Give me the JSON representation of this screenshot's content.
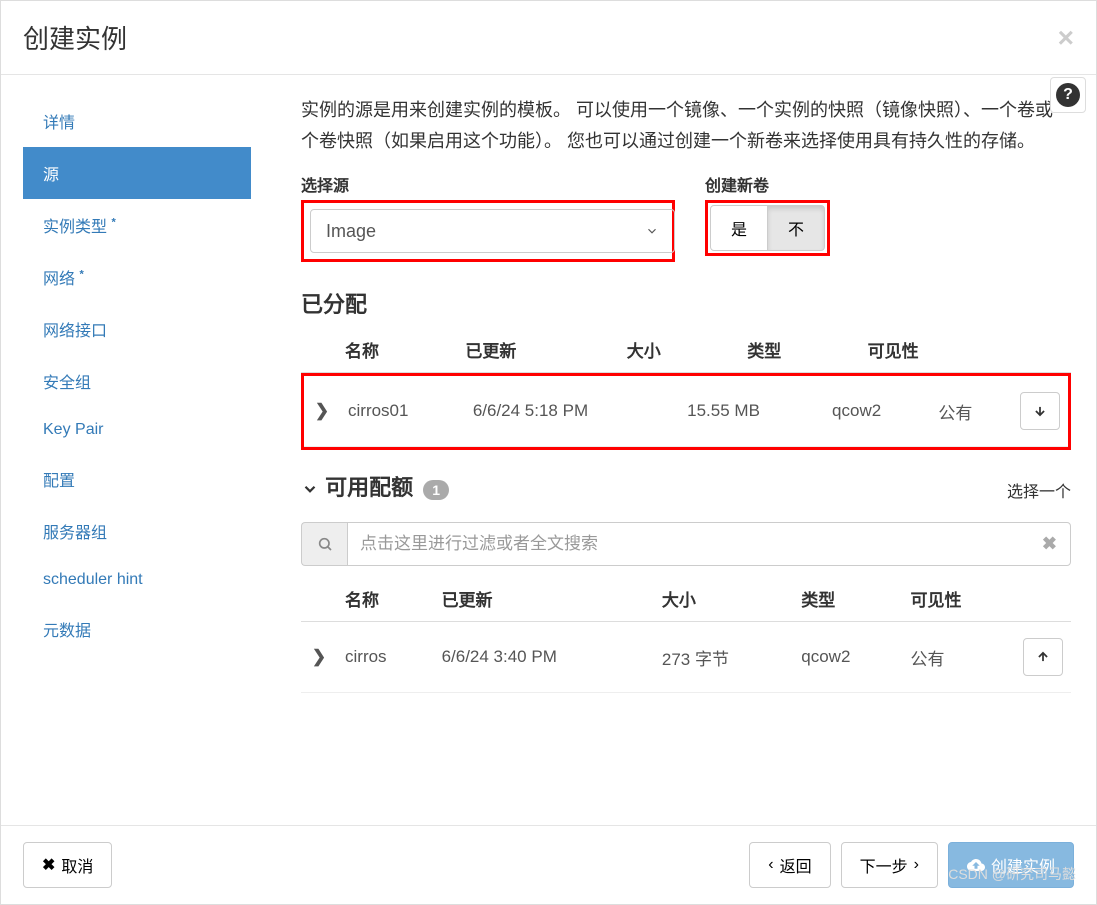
{
  "modal": {
    "title": "创建实例",
    "close": "×"
  },
  "sidebar": {
    "items": [
      {
        "label": "详情"
      },
      {
        "label": "源"
      },
      {
        "label": "实例类型",
        "req": "*"
      },
      {
        "label": "网络",
        "req": "*"
      },
      {
        "label": "网络接口"
      },
      {
        "label": "安全组"
      },
      {
        "label": "Key Pair"
      },
      {
        "label": "配置"
      },
      {
        "label": "服务器组"
      },
      {
        "label": "scheduler hint"
      },
      {
        "label": "元数据"
      }
    ]
  },
  "content": {
    "description": "实例的源是用来创建实例的模板。 可以使用一个镜像、一个实例的快照（镜像快照）、一个卷或一个卷快照（如果启用这个功能）。 您也可以通过创建一个新卷来选择使用具有持久性的存储。",
    "select_source_label": "选择源",
    "select_source_value": "Image",
    "create_volume_label": "创建新卷",
    "yes": "是",
    "no": "不",
    "allocated_title": "已分配",
    "available_title": "可用配额",
    "available_count": "1",
    "select_one": "选择一个",
    "search_placeholder": "点击这里进行过滤或者全文搜索",
    "headers": {
      "name": "名称",
      "updated": "已更新",
      "size": "大小",
      "type": "类型",
      "visibility": "可见性"
    },
    "allocated_rows": [
      {
        "name": "cirros01",
        "updated": "6/6/24 5:18 PM",
        "size": "15.55 MB",
        "type": "qcow2",
        "visibility": "公有"
      }
    ],
    "available_rows": [
      {
        "name": "cirros",
        "updated": "6/6/24 3:40 PM",
        "size": "273 字节",
        "type": "qcow2",
        "visibility": "公有"
      }
    ]
  },
  "footer": {
    "cancel": "取消",
    "back": "返回",
    "next": "下一步",
    "submit": "创建实例"
  },
  "watermark": "CSDN @研究司马懿"
}
